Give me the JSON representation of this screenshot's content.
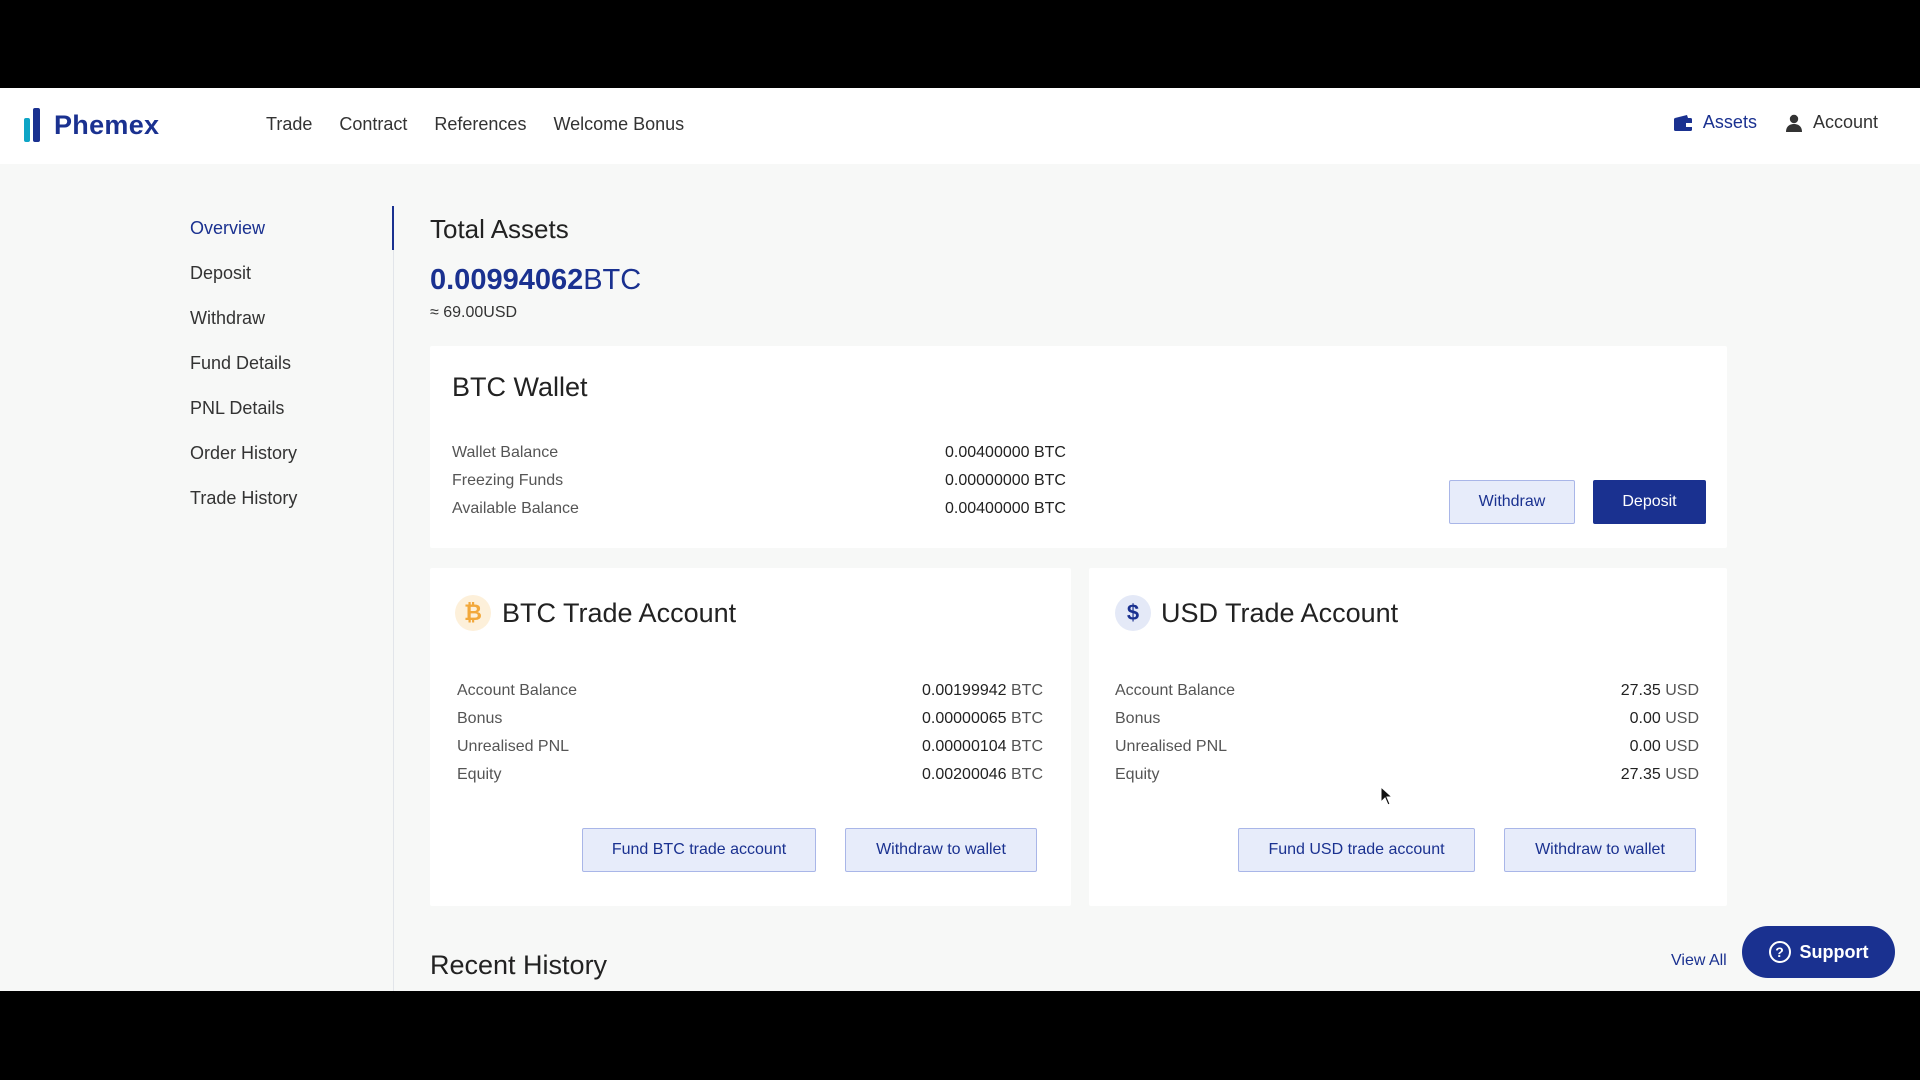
{
  "brand": {
    "name": "Phemex",
    "colors": {
      "primary": "#1a3190",
      "accent": "#0ea5c6",
      "btc": "#f2a83b"
    }
  },
  "nav": {
    "items": [
      "Trade",
      "Contract",
      "References",
      "Welcome Bonus"
    ]
  },
  "top_right": {
    "assets": "Assets",
    "account": "Account",
    "assets_icon": "wallet-icon",
    "account_icon": "user-icon"
  },
  "sidebar": {
    "items": [
      "Overview",
      "Deposit",
      "Withdraw",
      "Fund Details",
      "PNL Details",
      "Order History",
      "Trade History"
    ],
    "active": "Overview"
  },
  "total": {
    "title": "Total Assets",
    "btc_value": "0.00994062",
    "btc_unit": "BTC",
    "usd_prefix": "≈ 69.00",
    "usd_unit": "USD"
  },
  "btc_wallet": {
    "title": "BTC Wallet",
    "rows": [
      {
        "label": "Wallet Balance",
        "value": "0.00400000 BTC"
      },
      {
        "label": "Freezing Funds",
        "value": "0.00000000 BTC"
      },
      {
        "label": "Available Balance",
        "value": "0.00400000 BTC"
      }
    ],
    "withdraw_label": "Withdraw",
    "deposit_label": "Deposit"
  },
  "btc_trade": {
    "title": "BTC Trade Account",
    "icon": "bitcoin-icon",
    "rows": [
      {
        "label": "Account Balance",
        "value": "0.00199942",
        "unit": "BTC"
      },
      {
        "label": "Bonus",
        "value": "0.00000065",
        "unit": "BTC"
      },
      {
        "label": "Unrealised PNL",
        "value": "0.00000104",
        "unit": "BTC"
      },
      {
        "label": "Equity",
        "value": "0.00200046",
        "unit": "BTC"
      }
    ],
    "fund_label": "Fund BTC trade account",
    "withdraw_label": "Withdraw to wallet"
  },
  "usd_trade": {
    "title": "USD Trade Account",
    "icon": "dollar-icon",
    "rows": [
      {
        "label": "Account Balance",
        "value": "27.35",
        "unit": "USD"
      },
      {
        "label": "Bonus",
        "value": "0.00",
        "unit": "USD"
      },
      {
        "label": "Unrealised PNL",
        "value": "0.00",
        "unit": "USD"
      },
      {
        "label": "Equity",
        "value": "27.35",
        "unit": "USD"
      }
    ],
    "fund_label": "Fund USD trade account",
    "withdraw_label": "Withdraw to wallet"
  },
  "recent": {
    "title": "Recent History",
    "view_all": "View All"
  },
  "support": {
    "label": "Support"
  }
}
